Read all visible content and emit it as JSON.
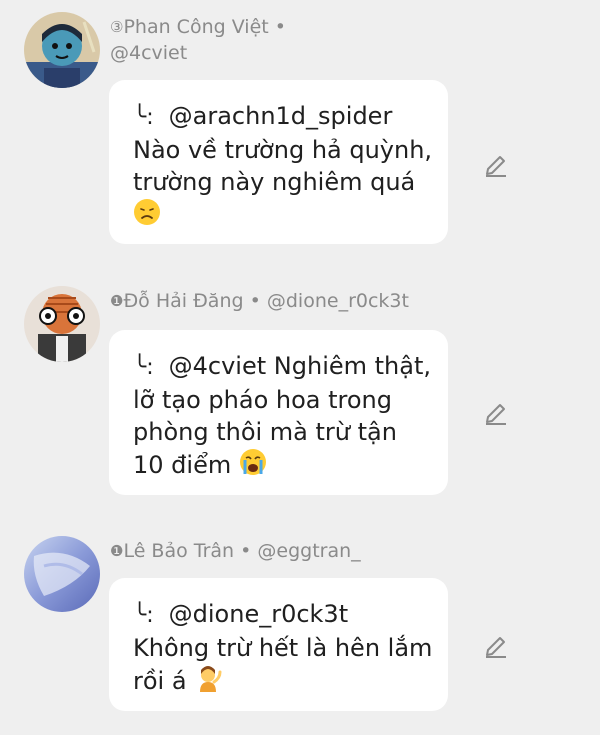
{
  "comments": [
    {
      "rank": "③",
      "name": "Phan Công Việt",
      "separator": "•",
      "handle": "@4cviet",
      "reply_marker": "╰:",
      "reply_to": "@arachn1d_spider",
      "lines": [
        "Nào về trường hả quỳnh,",
        "trường này nghiêm quá"
      ],
      "emoji": "disappointed-face"
    },
    {
      "rank": "❶",
      "name": "Đỗ Hải Đăng",
      "separator": "•",
      "handle": "@dione_r0ck3t",
      "reply_marker": "╰:",
      "reply_to": "@4cviet",
      "reply_rest": "Nghiêm thật,",
      "lines": [
        "lỡ tạo pháo hoa trong",
        "phòng thôi mà trừ tận",
        "10 điểm"
      ],
      "emoji": "crying-face"
    },
    {
      "rank": "❶",
      "name": "Lê Bảo Trân",
      "separator": "•",
      "handle": "@eggtran_",
      "reply_marker": "╰:",
      "reply_to": "@dione_r0ck3t",
      "lines": [
        "Không trừ hết là hên lắm",
        "rồi á"
      ],
      "emoji": "tipping-hand-person"
    }
  ],
  "icons": {
    "edit": "pencil-icon"
  },
  "colors": {
    "background": "#efefef",
    "bubble": "#ffffff",
    "meta_text": "#8a8a8a",
    "body_text": "#202020"
  }
}
